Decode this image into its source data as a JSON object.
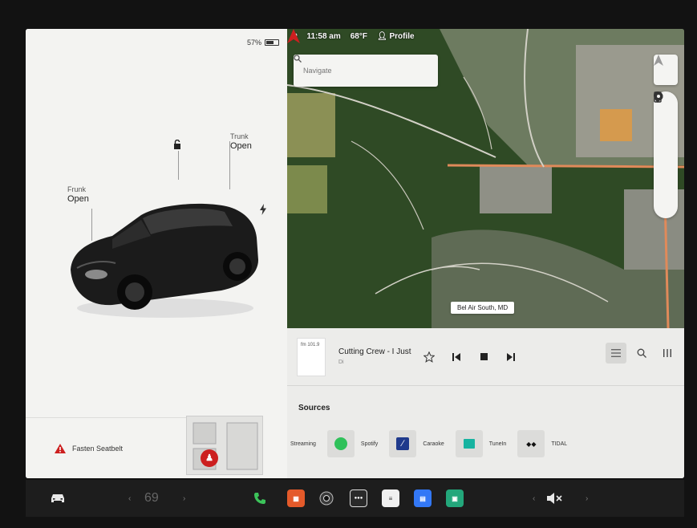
{
  "status_bar": {
    "time": "11:58 am",
    "temperature": "68°F",
    "profile_label": "Profile"
  },
  "car_panel": {
    "battery_label": "57%",
    "battery_fraction": 0.57,
    "frunk": {
      "label": "Frunk",
      "state": "Open"
    },
    "trunk": {
      "label": "Trunk",
      "state": "Open"
    },
    "seatbelt_warning": "Fasten Seatbelt"
  },
  "map": {
    "navigate_placeholder": "Navigate",
    "place_label": "Bel Air South, MD"
  },
  "media": {
    "album_art_text": "fm 101.9",
    "track_title": "Cutting Crew - I Just",
    "track_subtitle": "Di",
    "sources_title": "Sources",
    "sources": [
      {
        "label": "Streaming",
        "icon": "streaming-icon"
      },
      {
        "label": "Spotify",
        "icon": "spotify-icon"
      },
      {
        "label": "Caraoke",
        "icon": "caraoke-icon"
      },
      {
        "label": "TuneIn",
        "icon": "tunein-icon"
      },
      {
        "label": "TIDAL",
        "icon": "tidal-icon"
      }
    ]
  },
  "taskbar": {
    "temperature": "69",
    "apps": [
      "phone-icon",
      "calendar-icon",
      "camera-icon",
      "dashcam-icon",
      "notes-icon",
      "messages-icon",
      "toybox-icon"
    ]
  },
  "colors": {
    "accent_red": "#cc1f1f",
    "phone_green": "#3cc35a",
    "spotify_green": "#2fc15a",
    "messages_blue": "#3378f6"
  }
}
